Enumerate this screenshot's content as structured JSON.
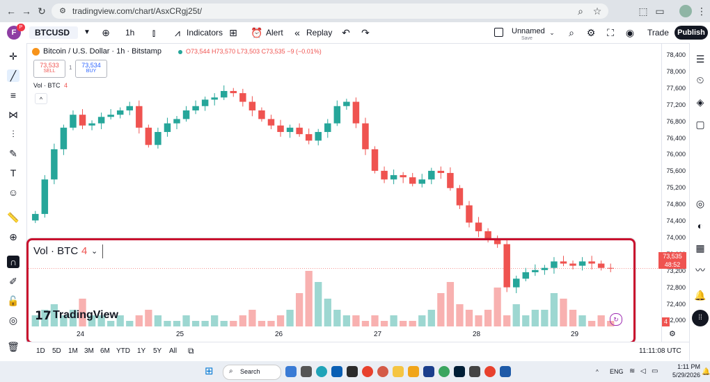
{
  "browser": {
    "url": "tradingview.com/chart/AsxCRgj25t/"
  },
  "toolbar": {
    "symbol": "BTCUSD",
    "interval": "1h",
    "indicators_label": "Indicators",
    "alert_label": "Alert",
    "replay_label": "Replay",
    "layout_name": "Unnamed",
    "layout_sub": "Save",
    "trade_label": "Trade",
    "publish_label": "Publish",
    "avatar_letter": "F",
    "avatar_badge": "P"
  },
  "legend": {
    "title": "Bitcoin / U.S. Dollar · 1h · Bitstamp",
    "o": "O73,544",
    "h": "H73,570",
    "l": "L73,503",
    "c": "C73,535",
    "change": "−9 (−0.01%)",
    "sell_price": "73,533",
    "sell_label": "SELL",
    "buy_price": "73,534",
    "buy_label": "BUY",
    "vol_small": "Vol · BTC",
    "vol_small_value": "4",
    "collapse": "^"
  },
  "volume_pane": {
    "label": "Vol · BTC",
    "value": "4",
    "watermark": "TradingView",
    "last_value_badge": "4"
  },
  "price_axis": {
    "ticks": [
      "78,400",
      "78,000",
      "77,600",
      "77,200",
      "76,800",
      "76,400",
      "76,000",
      "75,600",
      "75,200",
      "74,800",
      "74,400",
      "74,000",
      "73,600",
      "73,200",
      "72,800",
      "72,400",
      "72,000"
    ],
    "current_price": "73,535",
    "countdown": "48:52"
  },
  "time_axis": {
    "labels": [
      "24",
      "25",
      "26",
      "27",
      "28",
      "29"
    ]
  },
  "bottom_bar": {
    "ranges": [
      "1D",
      "5D",
      "1M",
      "3M",
      "6M",
      "YTD",
      "1Y",
      "5Y",
      "All"
    ],
    "clock": "11:11:08 UTC"
  },
  "taskbar": {
    "search_label": "Search",
    "lang": "ENG",
    "time": "1:11 PM",
    "date": "5/29/2026"
  },
  "colors": {
    "up": "#26a69a",
    "down": "#ef5350",
    "highlight": "#c8102e",
    "accent": "#2962ff"
  },
  "chart_data": {
    "type": "candlestick",
    "symbol": "BTCUSD",
    "timeframe": "1h",
    "x_labels": [
      "24",
      "25",
      "26",
      "27",
      "28",
      "29"
    ],
    "ylim": [
      72000,
      78600
    ],
    "close_path": [
      74800,
      75600,
      76300,
      76800,
      77100,
      76850,
      76900,
      77050,
      77100,
      77200,
      77300,
      76800,
      76400,
      76700,
      76900,
      77000,
      77200,
      77300,
      77450,
      77500,
      77650,
      77600,
      77400,
      77200,
      77000,
      76850,
      76700,
      76800,
      76650,
      76500,
      76700,
      76900,
      77300,
      77400,
      76900,
      76300,
      75800,
      75600,
      75700,
      75650,
      75500,
      75600,
      75800,
      75750,
      75400,
      75000,
      74600,
      74400,
      74200,
      74100,
      73100,
      73300,
      73450,
      73500,
      73550,
      73700,
      73650,
      73600,
      73700,
      73650,
      73550,
      73535
    ],
    "volume_relative": [
      0.2,
      0.3,
      0.4,
      0.2,
      0.3,
      0.5,
      0.2,
      0.2,
      0.1,
      0.2,
      0.1,
      0.2,
      0.3,
      0.2,
      0.1,
      0.1,
      0.2,
      0.1,
      0.1,
      0.2,
      0.1,
      0.1,
      0.2,
      0.3,
      0.1,
      0.1,
      0.2,
      0.3,
      0.6,
      1.0,
      0.8,
      0.5,
      0.3,
      0.2,
      0.2,
      0.1,
      0.2,
      0.1,
      0.2,
      0.1,
      0.1,
      0.2,
      0.3,
      0.6,
      0.8,
      0.4,
      0.3,
      0.2,
      0.3,
      0.7,
      0.2,
      0.4,
      0.2,
      0.3,
      0.3,
      0.6,
      0.5,
      0.3,
      0.2,
      0.1,
      0.2,
      0.1
    ]
  }
}
